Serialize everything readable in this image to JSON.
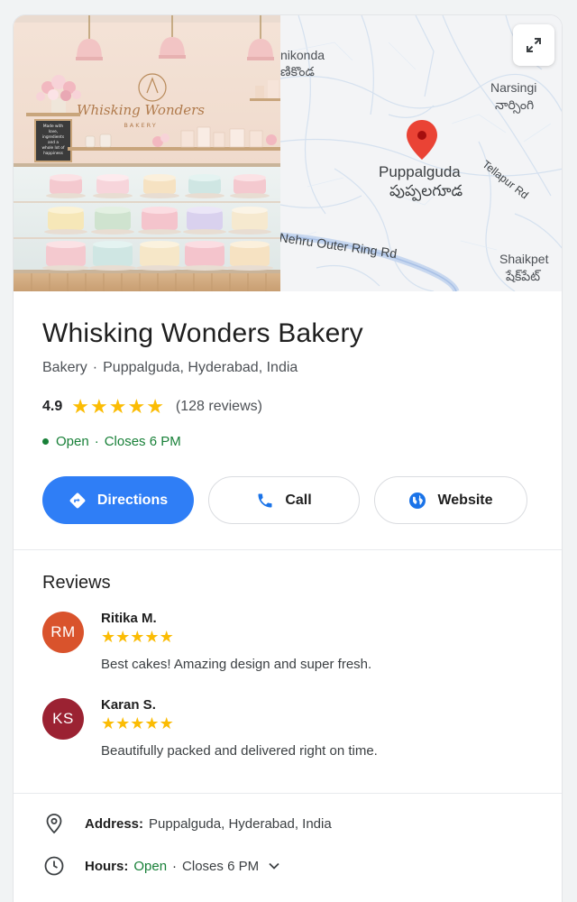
{
  "map": {
    "labels": {
      "manikonda": "nikonda",
      "manikonda_te": "ణికొండ",
      "narsingi": "Narsingi",
      "narsingi_te": "నార్సింగి",
      "tellapur_rd": "Tellapur Rd",
      "puppalguda": "Puppalguda",
      "puppalguda_te": "పుప్పలగూడ",
      "ring_road": "Nehru Outer Ring Rd",
      "shaikpet": "Shaikpet",
      "shaikpet_te": "షేక్‌పేట్"
    },
    "pin_color": "#ea4335",
    "expand_icon": "expand-icon"
  },
  "photo": {
    "sign_line1": "Whisking Wonders",
    "sign_line2": "BAKERY",
    "chalkboard": [
      "Made with",
      "love,",
      "ingredients",
      "and a",
      "whole lot of",
      "happiness"
    ]
  },
  "business": {
    "name": "Whisking Wonders Bakery",
    "category": "Bakery",
    "location": "Puppalguda, Hyderabad, India",
    "rating": "4.9",
    "stars": 5,
    "review_count": "(128 reviews)",
    "status": "Open",
    "closes": "Closes 6 PM",
    "separator": "·"
  },
  "actions": {
    "directions": "Directions",
    "call": "Call",
    "website": "Website"
  },
  "reviews": {
    "heading": "Reviews",
    "items": [
      {
        "initials": "RM",
        "name": "Ritika M.",
        "stars": 5,
        "text": "Best cakes! Amazing design and super fresh.",
        "avatar_color": "#d9532c"
      },
      {
        "initials": "KS",
        "name": "Karan S.",
        "stars": 5,
        "text": "Beautifully packed and delivered right on time.",
        "avatar_color": "#9b2232"
      }
    ]
  },
  "details": {
    "address_label": "Address:",
    "address_value": "Puppalguda, Hyderabad, India",
    "hours_label": "Hours:",
    "hours_status": "Open",
    "hours_closes": "Closes 6 PM"
  },
  "colors": {
    "accent": "#2f7ef6",
    "open_green": "#188038",
    "star_yellow": "#fbbc04"
  }
}
